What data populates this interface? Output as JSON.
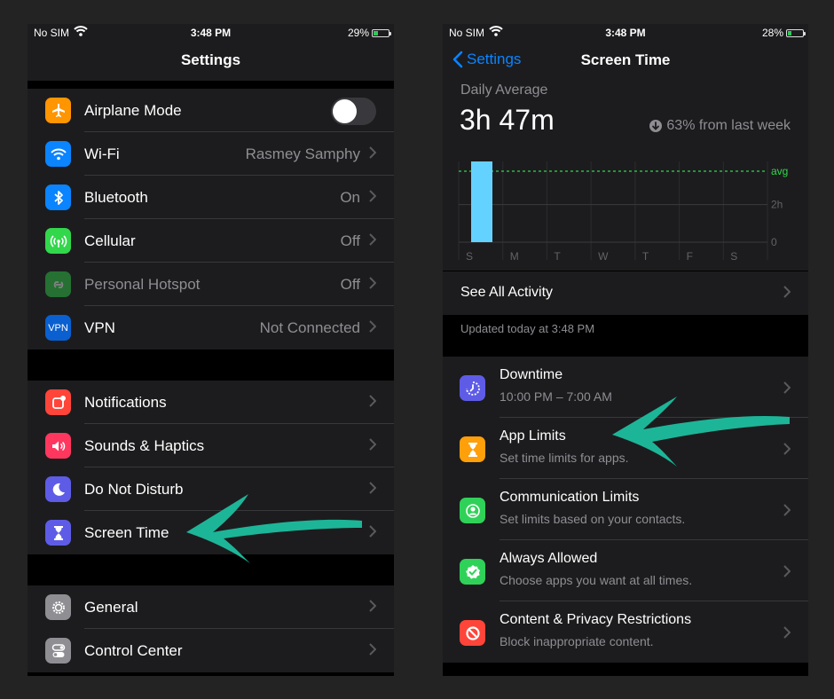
{
  "left": {
    "status": {
      "carrier": "No SIM",
      "time": "3:48 PM",
      "battery": "29%",
      "battery_level": 0.29
    },
    "title": "Settings",
    "group1": [
      {
        "label": "Airplane Mode",
        "value": "",
        "icon": "airplane-icon",
        "color": "#ff9500",
        "toggle": true
      },
      {
        "label": "Wi-Fi",
        "value": "Rasmey Samphy",
        "icon": "wifi-icon",
        "color": "#0a84ff"
      },
      {
        "label": "Bluetooth",
        "value": "On",
        "icon": "bluetooth-icon",
        "color": "#0a84ff"
      },
      {
        "label": "Cellular",
        "value": "Off",
        "icon": "cellular-icon",
        "color": "#32d74b"
      },
      {
        "label": "Personal Hotspot",
        "value": "Off",
        "icon": "hotspot-icon",
        "color": "#32d74b"
      },
      {
        "label": "VPN",
        "value": "Not Connected",
        "icon": "vpn-icon",
        "icon_text": "VPN",
        "color": "#0a60d0"
      }
    ],
    "group2": [
      {
        "label": "Notifications",
        "icon": "notifications-icon",
        "color": "#ff453a"
      },
      {
        "label": "Sounds & Haptics",
        "icon": "speaker-icon",
        "color": "#ff375f"
      },
      {
        "label": "Do Not Disturb",
        "icon": "moon-icon",
        "color": "#5e5ce6"
      },
      {
        "label": "Screen Time",
        "icon": "hourglass-icon",
        "color": "#5e5ce6"
      }
    ],
    "group3": [
      {
        "label": "General",
        "icon": "gear-icon",
        "color": "#8e8e93"
      },
      {
        "label": "Control Center",
        "icon": "switches-icon",
        "color": "#8e8e93"
      }
    ]
  },
  "right": {
    "status": {
      "carrier": "No SIM",
      "time": "3:48 PM",
      "battery": "28%",
      "battery_level": 0.28
    },
    "back_label": "Settings",
    "title": "Screen Time",
    "daily_label": "Daily Average",
    "daily_value": "3h 47m",
    "change_text": "63% from last week",
    "chart_data": {
      "type": "bar",
      "categories": [
        "S",
        "M",
        "T",
        "W",
        "T",
        "F",
        "S"
      ],
      "values": [
        4.3,
        0,
        0,
        0,
        0,
        0,
        0
      ],
      "ylim": [
        0,
        4.3
      ],
      "y_ticks": [
        {
          "label": "0",
          "value": 0
        },
        {
          "label": "2h",
          "value": 2
        }
      ],
      "avg_label": "avg",
      "avg_value": 3.78,
      "bar_color": "#64d2ff",
      "avg_color": "#32d74b",
      "grid": true
    },
    "see_all": "See All Activity",
    "updated": "Updated today at 3:48 PM",
    "items": [
      {
        "title": "Downtime",
        "sub": "10:00 PM – 7:00 AM",
        "icon": "downtime-icon",
        "color": "#5e5ce6"
      },
      {
        "title": "App Limits",
        "sub": "Set time limits for apps.",
        "icon": "hourglass-icon",
        "color": "#ff9f0a"
      },
      {
        "title": "Communication Limits",
        "sub": "Set limits based on your contacts.",
        "icon": "contact-icon",
        "color": "#30d158"
      },
      {
        "title": "Always Allowed",
        "sub": "Choose apps you want at all times.",
        "icon": "checkmark-badge-icon",
        "color": "#30d158"
      },
      {
        "title": "Content & Privacy Restrictions",
        "sub": "Block inappropriate content.",
        "icon": "no-entry-icon",
        "color": "#ff453a"
      }
    ]
  },
  "annotation_color": "#1db598"
}
